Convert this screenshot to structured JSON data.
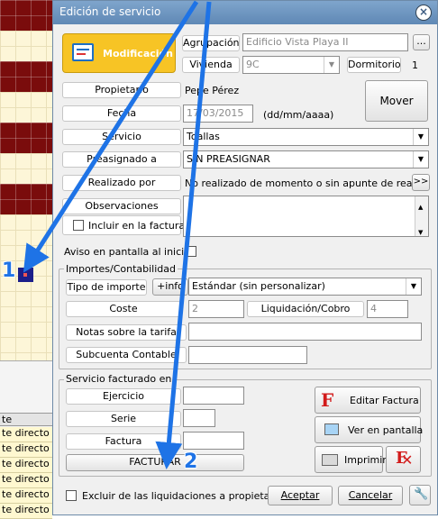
{
  "window": {
    "title": "Edición de servicio",
    "close_glyph": "×"
  },
  "header": {
    "mode_button": "Modificación",
    "agrupacion_label": "Agrupación",
    "agrupacion_value": "Edificio Vista Playa II",
    "agrupacion_more": "...",
    "vivienda_label": "Vivienda",
    "vivienda_value": "9C",
    "dormitorios_label": "Dormitorios",
    "dormitorios_value": "1"
  },
  "form": {
    "propietario_label": "Propietario",
    "propietario_value": "Pepe Pérez",
    "fecha_label": "Fecha",
    "fecha_value": "17/03/2015",
    "fecha_hint": "(dd/mm/aaaa)",
    "mover_button": "Mover",
    "servicio_label": "Servicio",
    "servicio_value": "Toallas",
    "preasignado_label": "Preasignado a",
    "preasignado_value": "SIN PREASIGNAR",
    "realizado_label": "Realizado por",
    "realizado_value": "No realizado de momento o sin apunte de realización",
    "realizado_more": ">>",
    "observaciones_label": "Observaciones",
    "incluir_factura_label": "Incluir en la factura",
    "aviso_label": "Aviso en pantalla al inicio"
  },
  "importes": {
    "title": "Importes/Contabilidad",
    "tipo_label": "Tipo de importe",
    "info_button": "+info",
    "tipo_value": "Estándar (sin personalizar)",
    "coste_label": "Coste",
    "coste_value": "2",
    "liquidacion_label": "Liquidación/Cobro",
    "liquidacion_value": "4",
    "notas_label": "Notas sobre la tarifa",
    "subcuenta_label": "Subcuenta Contable"
  },
  "facturado": {
    "title": "Servicio facturado en",
    "ejercicio_label": "Ejercicio",
    "serie_label": "Serie",
    "factura_label": "Factura",
    "facturar_button": "FACTURAR",
    "editar_factura_button": "Editar Factura",
    "ver_pantalla_button": "Ver en pantalla",
    "imprimir_button": "Imprimir"
  },
  "footer": {
    "excluir_label": "Excluir de las liquidaciones a propietarios",
    "aceptar_button": "Aceptar",
    "cancelar_button": "Cancelar"
  },
  "background": {
    "table_header": "te",
    "rows": [
      "te directo",
      "te directo",
      "te directo",
      "te directo",
      "te directo",
      "te directo"
    ]
  },
  "annotations": {
    "marker_1": "1",
    "marker_2": "2"
  },
  "colors": {
    "accent_yellow": "#f7c425",
    "arrow_blue": "#1e73e6",
    "title_blue": "#6a93c0"
  }
}
